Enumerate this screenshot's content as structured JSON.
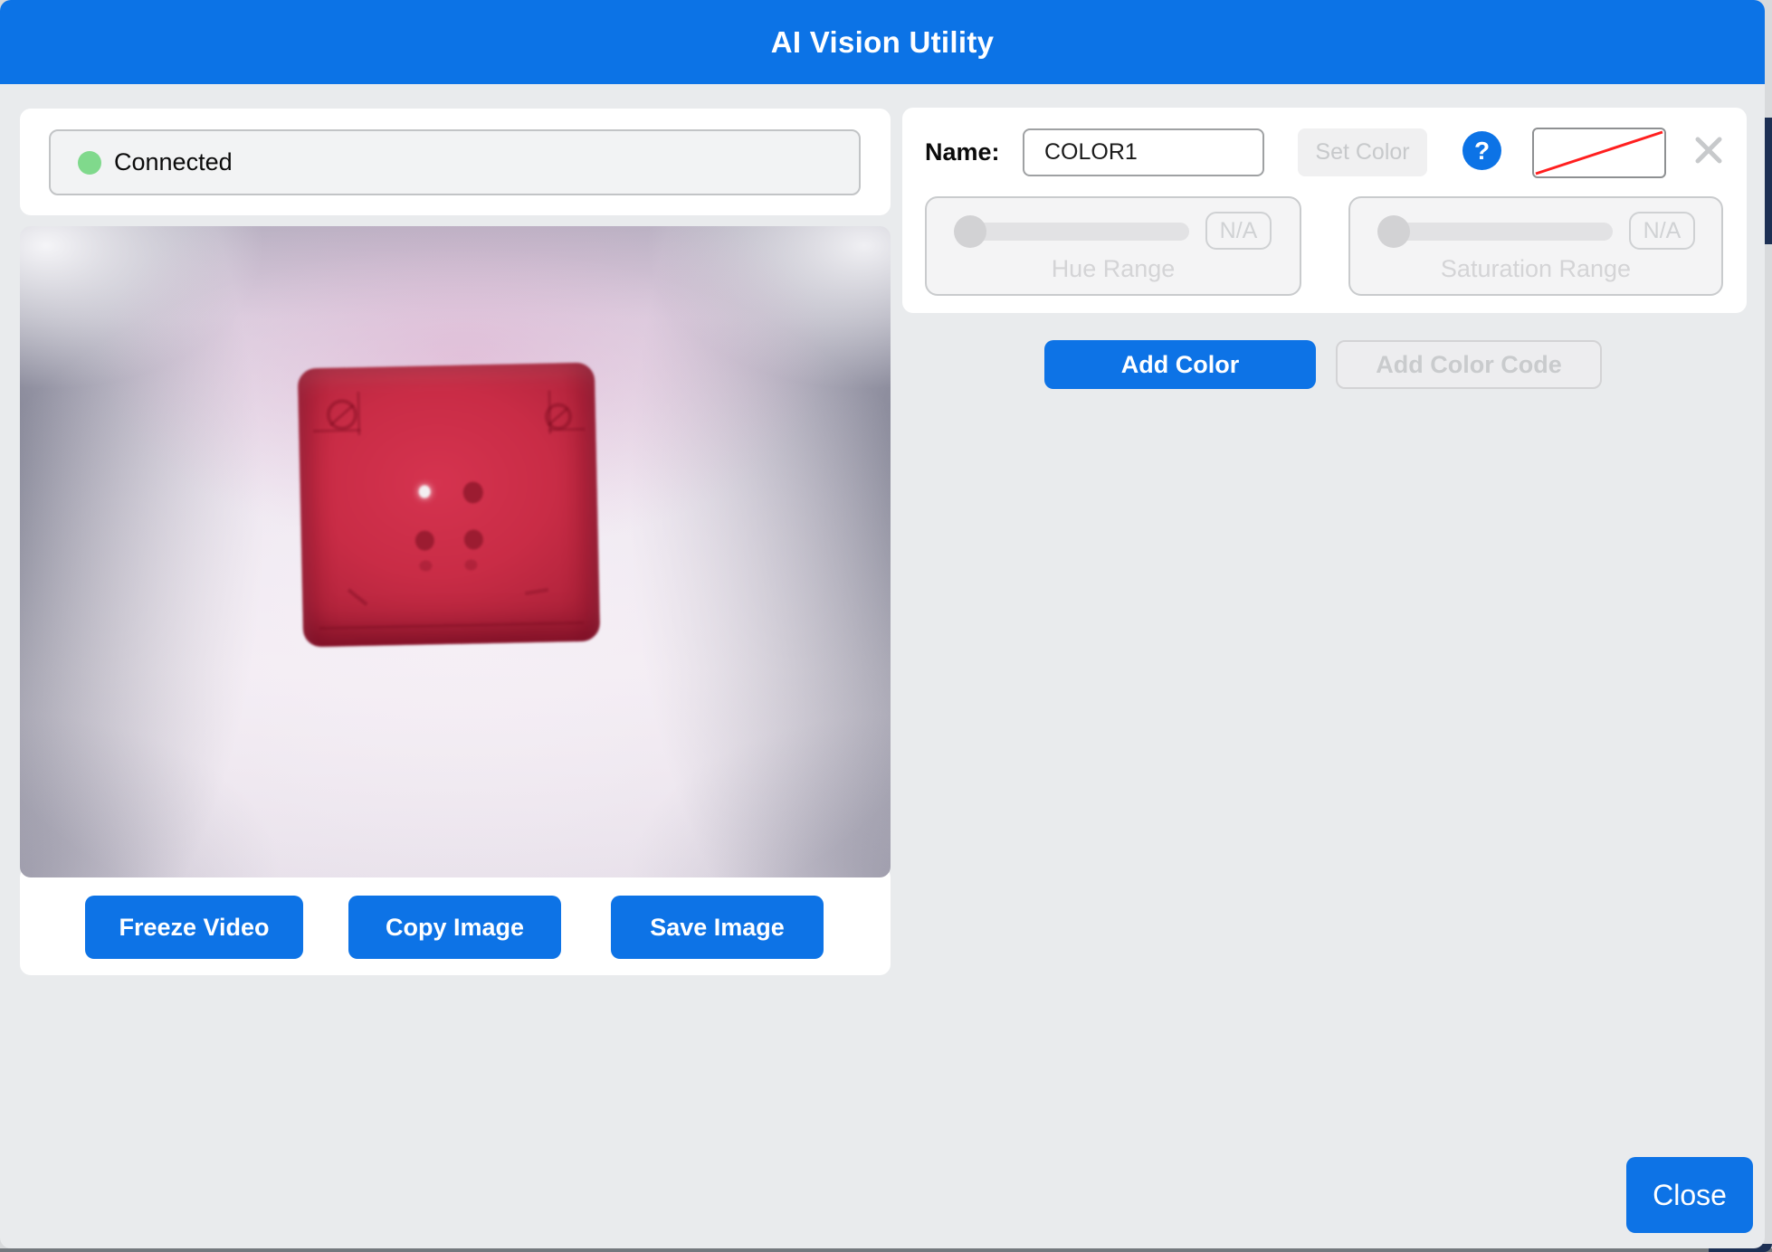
{
  "header": {
    "title": "AI Vision Utility"
  },
  "status": {
    "label": "Connected"
  },
  "video": {
    "buttons": [
      {
        "label": "Freeze Video"
      },
      {
        "label": "Copy Image"
      },
      {
        "label": "Save Image"
      }
    ]
  },
  "color_editor": {
    "name_label": "Name:",
    "name_value": "COLOR1",
    "set_color_label": "Set Color",
    "help_glyph": "?",
    "hue": {
      "badge": "N/A",
      "label": "Hue Range"
    },
    "saturation": {
      "badge": "N/A",
      "label": "Saturation Range"
    },
    "add_color_label": "Add Color",
    "add_color_code_label": "Add Color Code"
  },
  "footer": {
    "close_label": "Close"
  },
  "colors": {
    "accent_blue": "#0C73E6",
    "page_bg": "#E9EBED",
    "status_green": "#80D98C",
    "disabled_text": "#C9CBCD",
    "swatch_line_red": "#FF1F1F",
    "object_red": "#C72B45",
    "edge_navy": "#1D3054"
  }
}
